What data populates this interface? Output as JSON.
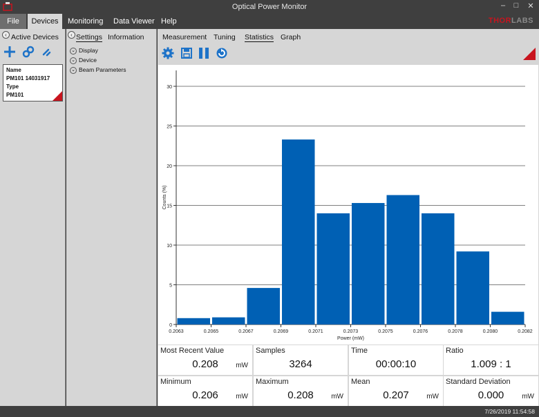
{
  "window": {
    "title": "Optical Power Monitor",
    "controls": [
      "–",
      "□",
      "✕"
    ]
  },
  "menu": [
    "File",
    "Devices",
    "Monitoring",
    "Data Viewer",
    "Help"
  ],
  "logo": {
    "part1": "THOR",
    "part2": "LABS"
  },
  "left_panel": {
    "header": "Active Devices",
    "device": {
      "name_key": "Name",
      "name_value": "PM101 14031917",
      "type_key": "Type",
      "type_value": "PM101"
    }
  },
  "mid_panel": {
    "tabs": [
      "Settings",
      "Information"
    ],
    "tree": [
      "Display",
      "Device",
      "Beam Parameters"
    ]
  },
  "right_panel": {
    "tabs": [
      "Measurement",
      "Tuning",
      "Statistics",
      "Graph"
    ],
    "active_tab": "Statistics"
  },
  "chart_data": {
    "type": "bar",
    "xlabel": "Power (mW)",
    "ylabel": "Counts (%)",
    "ylim": [
      0,
      32
    ],
    "yticks": [
      0,
      5,
      10,
      15,
      20,
      25,
      30
    ],
    "xtick_labels": [
      "0.2063",
      "0.2065",
      "0.2067",
      "0.2069",
      "0.2071",
      "0.2073",
      "0.2075",
      "0.2076",
      "0.2078",
      "0.2080",
      "0.2082"
    ],
    "values": [
      0.8,
      0.9,
      4.6,
      23.3,
      14.0,
      15.3,
      16.3,
      14.0,
      9.2,
      1.6
    ],
    "bar_color": "#0060b4",
    "grid": "horizontal"
  },
  "stats": [
    {
      "label": "Most Recent Value",
      "value": "0.208",
      "unit": "mW"
    },
    {
      "label": "Samples",
      "value": "3264",
      "unit": ""
    },
    {
      "label": "Time",
      "value": "00:00:10",
      "unit": ""
    },
    {
      "label": "Ratio",
      "value": "1.009 : 1",
      "unit": ""
    },
    {
      "label": "Minimum",
      "value": "0.206",
      "unit": "mW"
    },
    {
      "label": "Maximum",
      "value": "0.208",
      "unit": "mW"
    },
    {
      "label": "Mean",
      "value": "0.207",
      "unit": "mW"
    },
    {
      "label": "Standard Deviation",
      "value": "0.000",
      "unit": "mW"
    }
  ],
  "status": {
    "datetime": "7/26/2019 11:54:58"
  }
}
